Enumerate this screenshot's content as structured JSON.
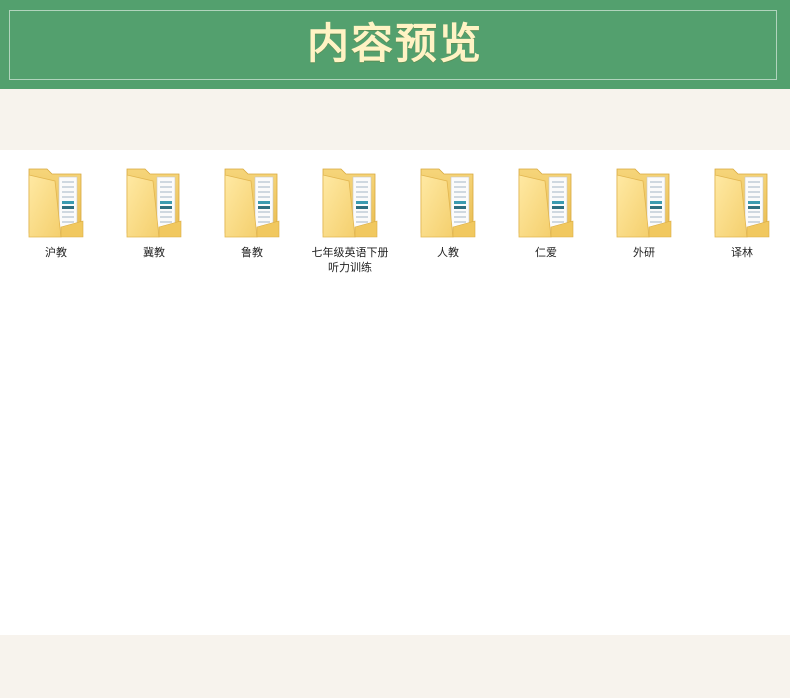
{
  "header": {
    "title": "内容预览"
  },
  "colors": {
    "header_bg": "#53a06e",
    "title_color": "#fff3c4",
    "band_bg": "#f7f3ed",
    "content_bg": "#ffffff"
  },
  "folders": [
    {
      "label": "沪教",
      "icon": "folder-icon"
    },
    {
      "label": "冀教",
      "icon": "folder-icon"
    },
    {
      "label": "鲁教",
      "icon": "folder-icon"
    },
    {
      "label": "七年级英语下册听力训练",
      "icon": "folder-icon"
    },
    {
      "label": "人教",
      "icon": "folder-icon"
    },
    {
      "label": "仁爱",
      "icon": "folder-icon"
    },
    {
      "label": "外研",
      "icon": "folder-icon"
    },
    {
      "label": "译林",
      "icon": "folder-icon"
    }
  ]
}
